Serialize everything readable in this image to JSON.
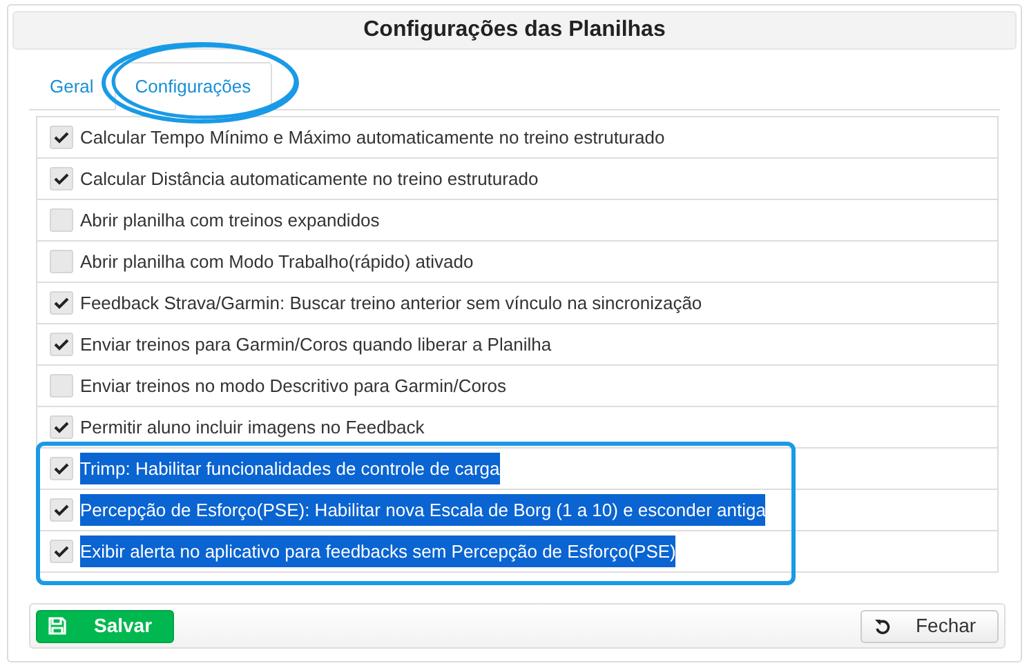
{
  "window": {
    "title": "Configurações das Planilhas"
  },
  "tabs": [
    {
      "label": "Geral",
      "selected": false
    },
    {
      "label": "Configurações",
      "selected": true
    }
  ],
  "options": [
    {
      "label": "Calcular Tempo Mínimo e Máximo automaticamente no treino estruturado",
      "checked": true,
      "highlighted": false
    },
    {
      "label": "Calcular Distância automaticamente no treino estruturado",
      "checked": true,
      "highlighted": false
    },
    {
      "label": "Abrir planilha com treinos expandidos",
      "checked": false,
      "highlighted": false
    },
    {
      "label": "Abrir planilha com Modo Trabalho(rápido) ativado",
      "checked": false,
      "highlighted": false
    },
    {
      "label": "Feedback Strava/Garmin: Buscar treino anterior sem vínculo na sincronização",
      "checked": true,
      "highlighted": false
    },
    {
      "label": "Enviar treinos para Garmin/Coros quando liberar a Planilha",
      "checked": true,
      "highlighted": false
    },
    {
      "label": "Enviar treinos no modo Descritivo para Garmin/Coros",
      "checked": false,
      "highlighted": false
    },
    {
      "label": "Permitir aluno incluir imagens no Feedback",
      "checked": true,
      "highlighted": false
    },
    {
      "label": "Trimp: Habilitar funcionalidades de controle de carga",
      "checked": true,
      "highlighted": true
    },
    {
      "label": "Percepção de Esforço(PSE): Habilitar nova Escala de Borg (1 a 10) e esconder antiga",
      "checked": true,
      "highlighted": true
    },
    {
      "label": "Exibir alerta no aplicativo para feedbacks sem Percepção de Esforço(PSE)",
      "checked": true,
      "highlighted": true
    }
  ],
  "buttons": [
    {
      "label": "Salvar",
      "kind": "save"
    },
    {
      "label": "Fechar",
      "kind": "close"
    }
  ]
}
